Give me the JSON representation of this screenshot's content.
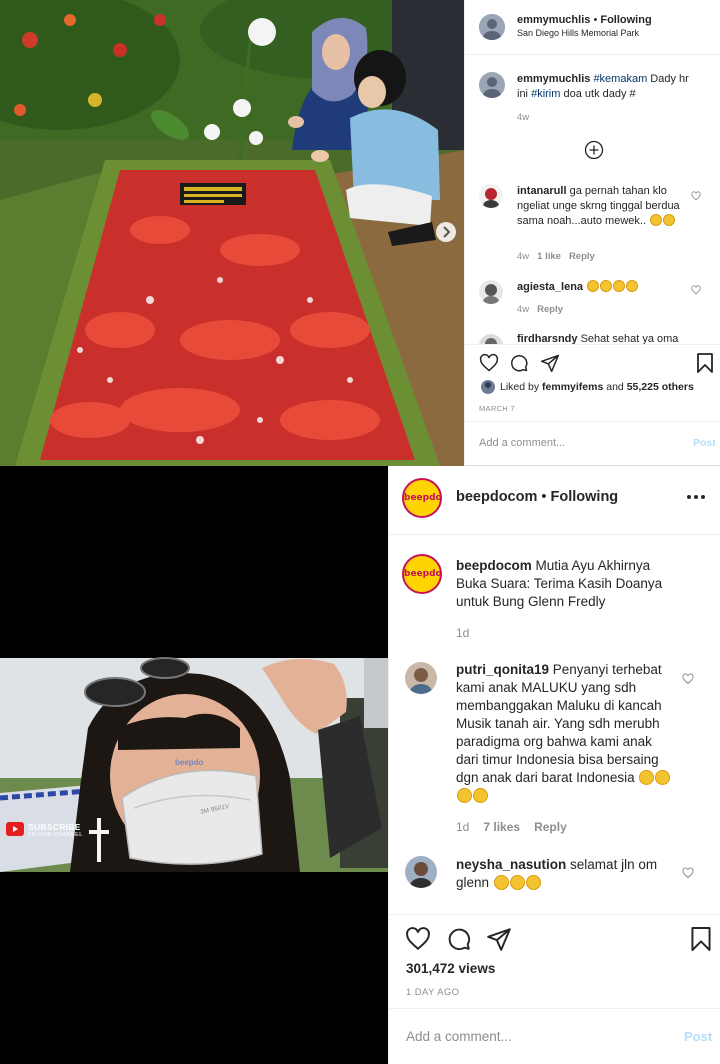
{
  "post1": {
    "header": {
      "username": "emmymuchlis",
      "follow_status": "Following",
      "location": "San Diego Hills Memorial Park"
    },
    "caption": {
      "username": "emmymuchlis",
      "parts": [
        "#kemakam",
        "Dady hr ini",
        "#kirim",
        "doa utk dady #"
      ],
      "age": "4w"
    },
    "comments": [
      {
        "username": "intanarull",
        "text": "ga pernah tahan klo ngeliat unge skrng tinggal berdua sama noah...auto mewek..",
        "age": "4w",
        "likes": "1 like",
        "reply": "Reply"
      },
      {
        "username": "agiesta_lena",
        "text": "",
        "age": "4w",
        "reply": "Reply"
      },
      {
        "username": "firdharsndy",
        "text": "Sehat sehat ya oma"
      }
    ],
    "liked_by": {
      "prefix": "Liked by",
      "user": "femmyifems",
      "and": "and",
      "others": "55,225 others"
    },
    "date": "MARCH 7",
    "comment_placeholder": "Add a comment...",
    "post_button": "Post"
  },
  "post2": {
    "header": {
      "username": "beepdocom",
      "follow_status": "Following"
    },
    "avatar_text": "beepdo",
    "caption": {
      "username": "beepdocom",
      "text": "Mutia Ayu Akhirnya Buka Suara: Terima Kasih Doanya untuk Bung Glenn Fredly",
      "age": "1d"
    },
    "comments": [
      {
        "username": "putri_qonita19",
        "text": "Penyanyi terhebat kami anak MALUKU yang sdh membanggakan Maluku di kancah Musik tanah air. Yang sdh merubh paradigma org bahwa kami anak dari timur Indonesia bisa bersaing dgn anak dari barat Indonesia",
        "age": "1d",
        "likes": "7 likes",
        "reply": "Reply"
      },
      {
        "username": "neysha_nasution",
        "text": "selamat jln om glenn"
      }
    ],
    "video_overlay": {
      "subscribe": "SUBSCRIBE",
      "subscribe_sub": "TO OUR CHANNEL",
      "watermark": "beepdo",
      "mask_text": "3M 9501V"
    },
    "views": "301,472 views",
    "date": "1 DAY AGO",
    "comment_placeholder": "Add a comment...",
    "post_button": "Post"
  },
  "colors": {
    "link": "#00376b",
    "post_button": "#b2dffb",
    "petal_red": "#e8232a",
    "mask": "#e9e9e9"
  }
}
